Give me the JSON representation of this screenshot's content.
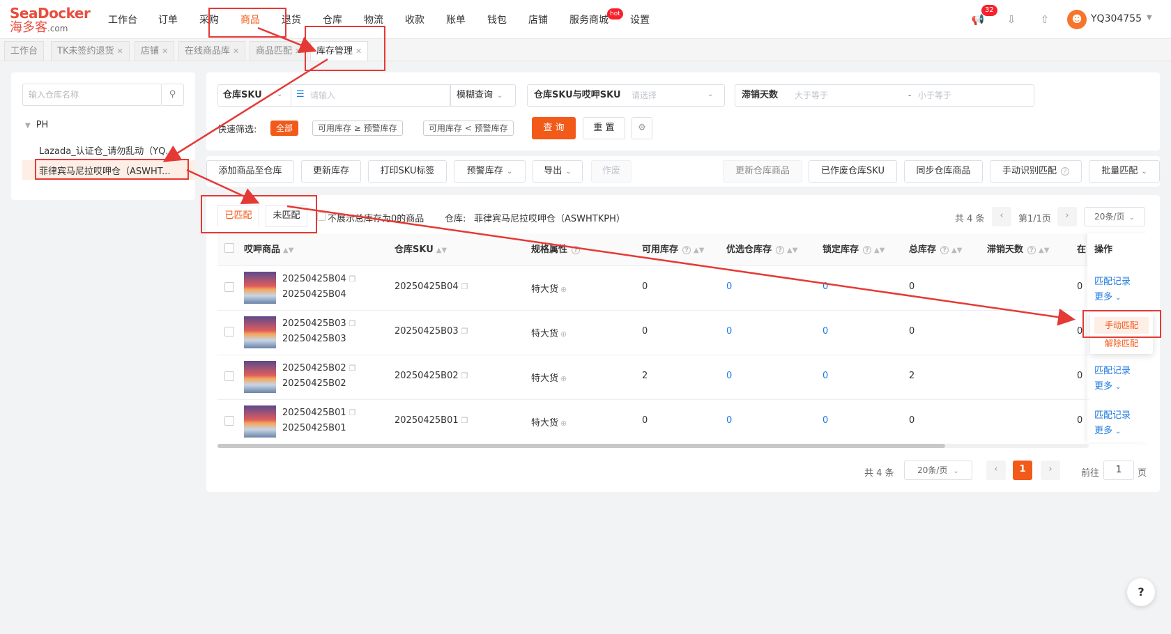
{
  "logo": {
    "brand_a": "SeaDocker",
    "brand_b": "海多客",
    "brand_c": ".com"
  },
  "nav": {
    "items": [
      "工作台",
      "订单",
      "采购",
      "商品",
      "退货",
      "仓库",
      "物流",
      "收款",
      "账单",
      "钱包",
      "店铺",
      "服务商城",
      "设置"
    ],
    "active": "商品"
  },
  "top": {
    "notif_count": "32",
    "service_badge": "hot",
    "username": "YQ304755"
  },
  "tabs": [
    "工作台",
    "TK未签约退货",
    "店铺",
    "在线商品库",
    "商品匹配",
    "库存管理"
  ],
  "sidebar": {
    "search_placeholder": "输入仓库名称",
    "group": "PH",
    "items": [
      "Lazada_认证仓_请勿乱动（YQ...",
      "菲律宾马尼拉哎呷仓（ASWHT..."
    ]
  },
  "filters": {
    "sku_label": "仓库SKU",
    "sku_placeholder": "请输入",
    "mode": "模糊查询",
    "map_label": "仓库SKU与哎呷SKU",
    "map_placeholder": "请选择",
    "stale_label": "滞销天数",
    "min_placeholder": "大于等于",
    "dash": "-",
    "max_placeholder": "小于等于",
    "quick_label": "快速筛选:",
    "chips": [
      "全部",
      "可用库存 ≥ 预警库存",
      "可用库存 < 预警库存"
    ],
    "query": "查 询",
    "reset": "重 置"
  },
  "toolbar": {
    "left": [
      "添加商品至仓库",
      "更新库存",
      "打印SKU标签",
      "预警库存",
      "导出",
      "作废"
    ],
    "right": [
      "更新仓库商品",
      "已作废仓库SKU",
      "同步仓库商品",
      "手动识别匹配",
      "批量匹配"
    ]
  },
  "list": {
    "tab_matched": "已匹配",
    "tab_unmatched": "未匹配",
    "hide_zero": "不展示总库存为0的商品",
    "warehouse_label": "仓库:",
    "warehouse_name": "菲律宾马尼拉哎呷仓（ASWHTKPH）",
    "total_top": "共 4 条",
    "page_info": "第1/1页",
    "page_size": "20条/页",
    "headers": [
      "哎呷商品",
      "仓库SKU",
      "规格属性",
      "可用库存",
      "优选仓库存",
      "锁定库存",
      "总库存",
      "滞销天数",
      "在",
      "操作"
    ],
    "rows": [
      {
        "sku1": "20250425B04",
        "sku2": "20250425B04",
        "wsku": "20250425B04",
        "attr": "特大货",
        "avail": "0",
        "pref": "0",
        "lock": "0",
        "total": "0",
        "inv": "0"
      },
      {
        "sku1": "20250425B03",
        "sku2": "20250425B03",
        "wsku": "20250425B03",
        "attr": "特大货",
        "avail": "0",
        "pref": "0",
        "lock": "0",
        "total": "0",
        "inv": "0"
      },
      {
        "sku1": "20250425B02",
        "sku2": "20250425B02",
        "wsku": "20250425B02",
        "attr": "特大货",
        "avail": "2",
        "pref": "0",
        "lock": "0",
        "total": "2",
        "inv": "0"
      },
      {
        "sku1": "20250425B01",
        "sku2": "20250425B01",
        "wsku": "20250425B01",
        "attr": "特大货",
        "avail": "0",
        "pref": "0",
        "lock": "0",
        "total": "0",
        "inv": "0"
      }
    ],
    "ops": {
      "record": "匹配记录",
      "more": "更多",
      "manual": "手动匹配",
      "unmatch": "解除匹配"
    }
  },
  "pager": {
    "total": "共 4 条",
    "size": "20条/页",
    "current": "1",
    "goto": "前往",
    "goto_value": "1",
    "page_unit": "页"
  },
  "help": "?"
}
